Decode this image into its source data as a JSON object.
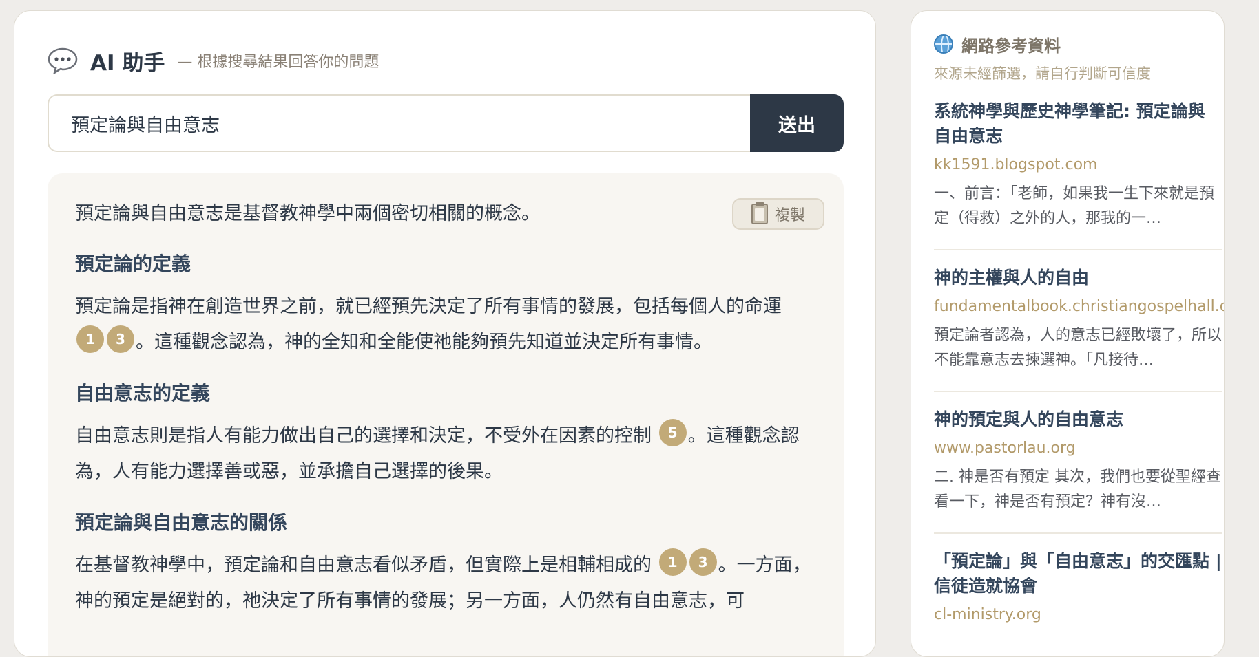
{
  "header": {
    "title": "AI 助手",
    "subtitle": "— 根據搜尋結果回答你的問題",
    "icon": "speech-bubble-icon"
  },
  "search": {
    "value": "預定論與自由意志",
    "send_label": "送出"
  },
  "answer": {
    "copy_label": "複製",
    "intro": "預定論與自由意志是基督教神學中兩個密切相關的概念。",
    "sections": [
      {
        "heading": "預定論的定義",
        "text_before": "預定論是指神在創造世界之前，就已經預先決定了所有事情的發展，包括每個人的命運",
        "citations": [
          "1",
          "3"
        ],
        "text_after": "。這種觀念認為，神的全知和全能使祂能夠預先知道並決定所有事情。"
      },
      {
        "heading": "自由意志的定義",
        "text_before": "自由意志則是指人有能力做出自己的選擇和決定，不受外在因素的控制",
        "citations": [
          "5"
        ],
        "text_after": "。這種觀念認為，人有能力選擇善或惡，並承擔自己選擇的後果。"
      },
      {
        "heading": "預定論與自由意志的關係",
        "text_before": "在基督教神學中，預定論和自由意志看似矛盾，但實際上是相輔相成的",
        "citations": [
          "1",
          "3"
        ],
        "text_after": "。一方面，神的預定是絕對的，祂決定了所有事情的發展；另一方面，人仍然有自由意志，可"
      }
    ]
  },
  "references": {
    "title": "網路參考資料",
    "note": "來源未經篩選，請自行判斷可信度",
    "items": [
      {
        "title": "系統神學與歷史神學筆記: 預定論與自由意志",
        "domain": "kk1591.blogspot.com",
        "snippet": "一、前言：「老師，如果我一生下來就是預定（得救）之外的人，那我的一…"
      },
      {
        "title": "神的主權與人的自由",
        "domain": "fundamentalbook.christiangospelhall.org",
        "snippet": "預定論者認為，人的意志已經敗壞了，所以不能靠意志去揀選神。「凡接待…"
      },
      {
        "title": "神的預定與人的自由意志",
        "domain": "www.pastorlau.org",
        "snippet": "二. 神是否有預定 其次，我們也要從聖經查看一下，神是否有預定？神有沒…"
      },
      {
        "title": "「預定論」與「自由意志」的交匯點 | 信徒造就協會",
        "domain": "cl-ministry.org",
        "snippet": ""
      }
    ]
  },
  "colors": {
    "accent_dark": "#2d3846",
    "citation_badge": "#c2aa78",
    "domain_text": "#b29a6a",
    "background": "#efedea"
  }
}
